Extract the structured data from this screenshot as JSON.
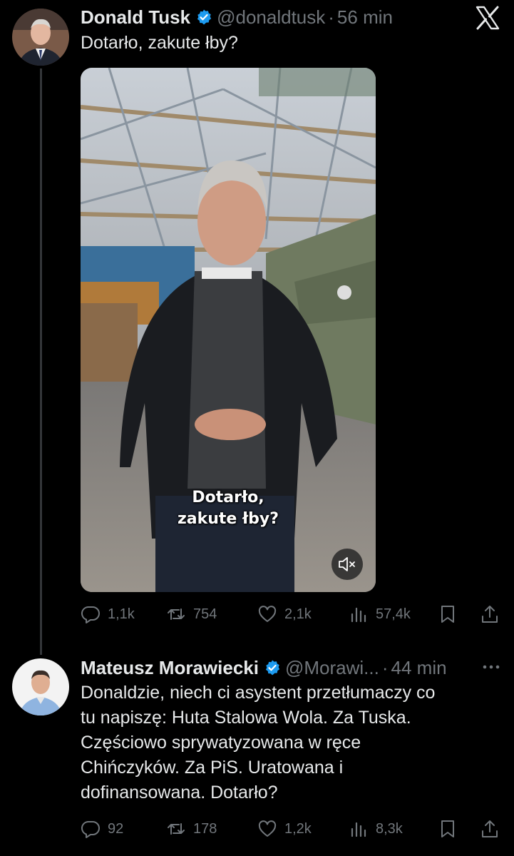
{
  "tweet_main": {
    "display_name": "Donald Tusk",
    "handle": "@donaldtusk",
    "separator": "·",
    "time": "56 min",
    "text": "Dotarło, zakute łby?",
    "video_caption_line1": "Dotarło,",
    "video_caption_line2": "zakute łby?",
    "stats": {
      "replies": "1,1k",
      "retweets": "754",
      "likes": "2,1k",
      "views": "57,4k"
    }
  },
  "tweet_reply": {
    "display_name": "Mateusz Morawiecki",
    "handle": "@Morawi...",
    "separator": "·",
    "time": "44 min",
    "text": "Donaldzie, niech ci asystent przetłumaczy co\ntu napiszę: Huta Stalowa Wola. Za Tuska.\nCzęściowo sprywatyzowana w ręce\nChińczyków. Za PiS. Uratowana i\ndofinansowana. Dotarło?",
    "stats": {
      "replies": "92",
      "retweets": "178",
      "likes": "1,2k",
      "views": "8,3k"
    }
  },
  "colors": {
    "background": "#000000",
    "text": "#e7e9ea",
    "muted": "#71767b",
    "verified": "#1d9bf0",
    "thread_line": "#333639"
  },
  "icons": [
    "x-logo-icon",
    "verified-badge-icon",
    "more-icon",
    "mute-icon",
    "reply-icon",
    "retweet-icon",
    "like-icon",
    "views-icon",
    "bookmark-icon",
    "share-icon"
  ]
}
